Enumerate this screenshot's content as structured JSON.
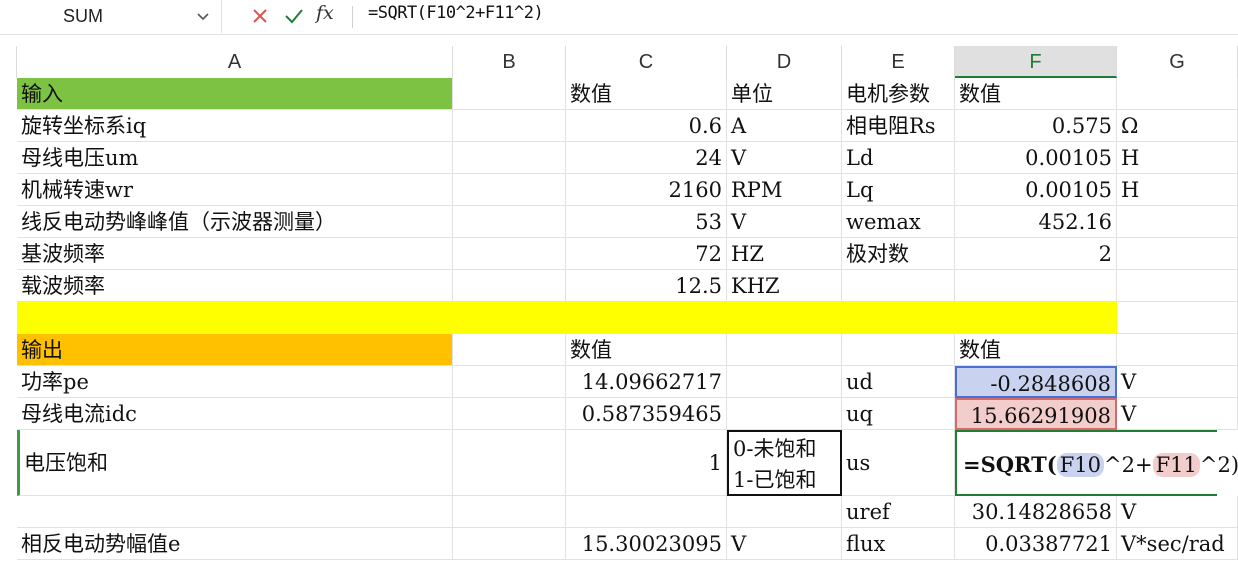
{
  "formula_bar": {
    "name_box": "SUM",
    "formula": "=SQRT(F10^2+F11^2)"
  },
  "columns": [
    "A",
    "B",
    "C",
    "D",
    "E",
    "F",
    "G"
  ],
  "colors": {
    "green": "#7dc242",
    "yellow": "#ffff00",
    "orange": "#ffc000",
    "blue_ref": "#c9d3f0",
    "red_ref": "#f3cccc",
    "active_border": "#1e7e34"
  },
  "sheet": {
    "r1": {
      "a": "输入",
      "c": "数值",
      "d": "单位",
      "e": "电机参数",
      "f": "数值"
    },
    "r2": {
      "a": "旋转坐标系iq",
      "c": "0.6",
      "d": "A",
      "e": "相电阻Rs",
      "f": "0.575",
      "g": "Ω"
    },
    "r3": {
      "a": "母线电压um",
      "c": "24",
      "d": "V",
      "e": "Ld",
      "f": "0.00105",
      "g": "H"
    },
    "r4": {
      "a": "机械转速wr",
      "c": "2160",
      "d": "RPM",
      "e": "Lq",
      "f": "0.00105",
      "g": "H"
    },
    "r5": {
      "a": "线反电动势峰峰值（示波器测量）",
      "c": "53",
      "d": "V",
      "e": "wemax",
      "f": "452.16"
    },
    "r6": {
      "a": "基波频率",
      "c": "72",
      "d": "HZ",
      "e": "极对数",
      "f": "2"
    },
    "r7": {
      "a": "载波频率",
      "c": "12.5",
      "d": "KHZ"
    },
    "r9": {
      "a": "输出",
      "c": "数值",
      "f": "数值"
    },
    "r10": {
      "a": "功率pe",
      "c": "14.09662717",
      "e": "ud",
      "f": "-0.2848608",
      "g": "V"
    },
    "r11": {
      "a": "母线电流idc",
      "c": "0.587359465",
      "e": "uq",
      "f": "15.66291908",
      "g": "V"
    },
    "r12": {
      "a": "电压饱和",
      "c": "1",
      "d1": "0-未饱和",
      "d2": "1-已饱和",
      "e": "us",
      "f_parts": [
        "=SQRT(",
        "F10",
        "^2+",
        "F11",
        "^2)"
      ]
    },
    "r13": {
      "e": "uref",
      "f": "30.14828658",
      "g": "V"
    },
    "r14": {
      "a": "相反电动势幅值e",
      "c": "15.30023095",
      "d": "V",
      "e": "flux",
      "f": "0.03387721",
      "g": "V*sec/rad"
    }
  }
}
